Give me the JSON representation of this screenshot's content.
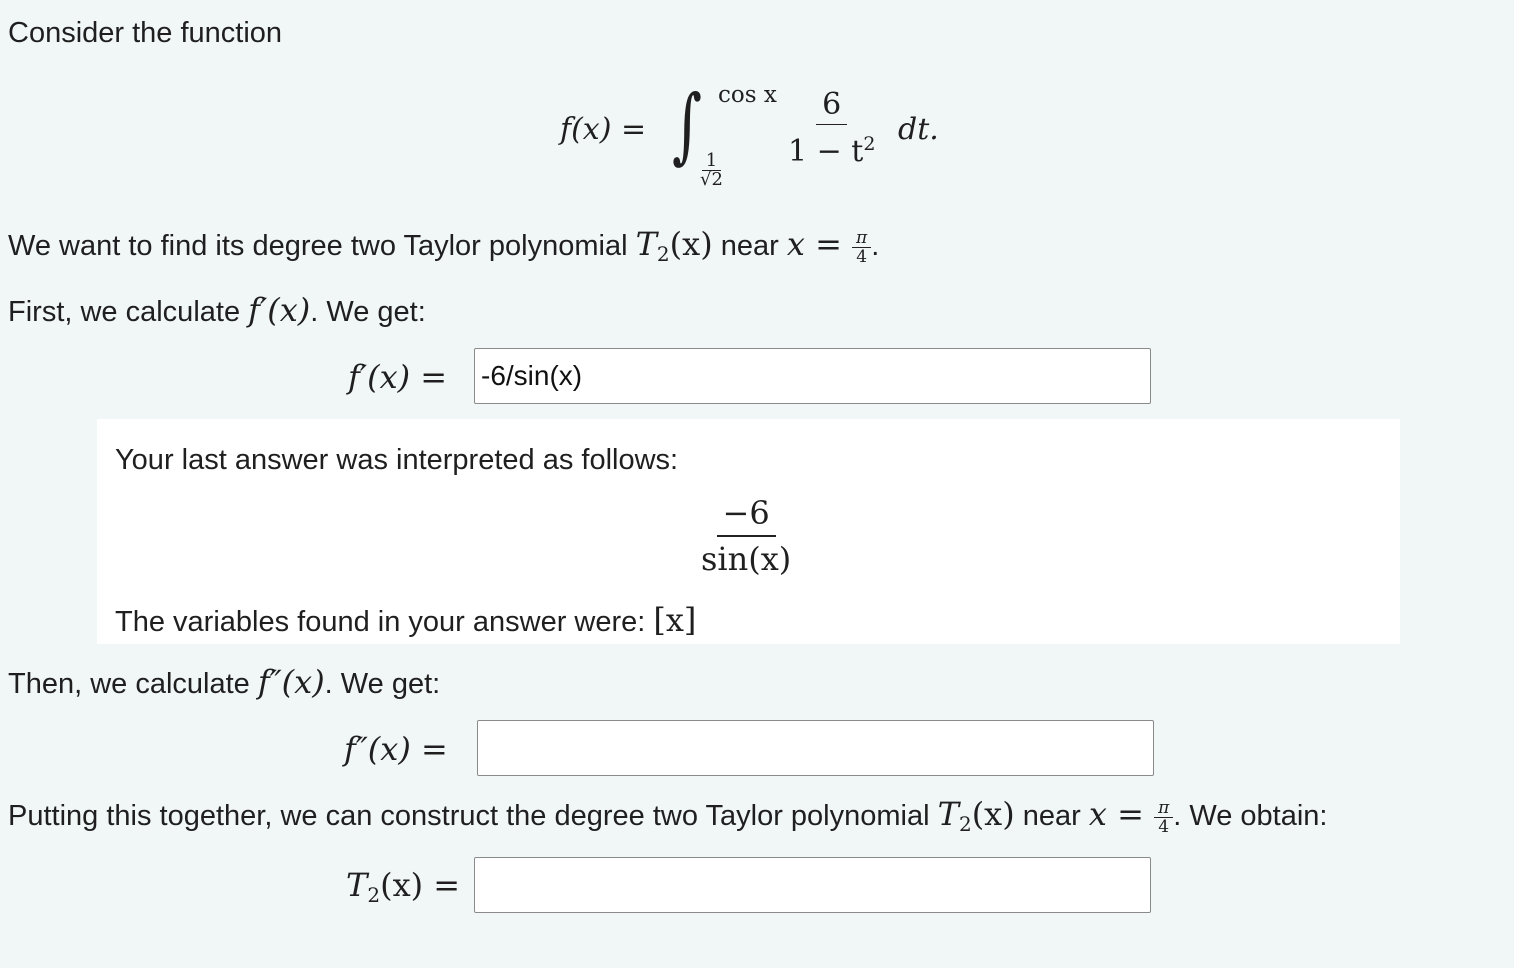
{
  "intro": "Consider the function",
  "function_def": {
    "lhs": "f(x) =",
    "upper_limit": "cos x",
    "lower_limit_num": "1",
    "lower_limit_den": "√2",
    "integrand_num": "6",
    "integrand_den_a": "1 − t",
    "integrand_den_exp": "2",
    "differential": "dt."
  },
  "goal": {
    "text_before": "We want to find its degree two Taylor polynomial ",
    "T": "T",
    "sub": "2",
    "args": "(x)",
    "text_near": " near ",
    "x_eq": "x = ",
    "pi": "π",
    "four": "4",
    "period": "."
  },
  "step1": {
    "text_before": "First, we calculate ",
    "fprime": "f′(x)",
    "text_after": ". We get:",
    "label": "f′(x) =",
    "value": "-6/sin(x)"
  },
  "feedback": {
    "heading": "Your last answer was interpreted as follows:",
    "num": "−6",
    "den": "sin(x)",
    "vars_text": "The variables found in your answer were: ",
    "vars": "[x]"
  },
  "step2": {
    "text_before": "Then, we calculate ",
    "fdouble": "f″(x)",
    "text_after": ". We get:",
    "label": "f″(x) =",
    "value": ""
  },
  "step3": {
    "text_before": "Putting this together, we can construct the degree two Taylor polynomial ",
    "T": "T",
    "sub": "2",
    "args": "(x)",
    "text_near": " near ",
    "x_eq": "x = ",
    "pi": "π",
    "four": "4",
    "text_after": ". We obtain:",
    "label_T": "T",
    "label_sub": "2",
    "label_rest": "(x) =",
    "value": ""
  }
}
